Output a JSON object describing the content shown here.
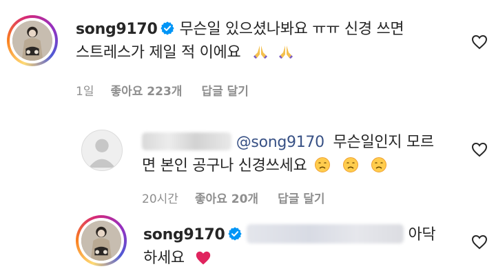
{
  "comments": [
    {
      "username": "song9170",
      "text_line1": "무슨일 있으셨나봐요 ㅠㅠ 신경 쓰면",
      "text_line2": "스트레스가 제일 적 이에요",
      "time": "1일",
      "likes": "좋아요 223개",
      "reply": "답글 달기",
      "verified": true,
      "emoji": "folded-hands"
    },
    {
      "mention": "@song9170",
      "text_line1": "무슨일인지 모르",
      "text_line2": "면 본인 공구나 신경쓰세요",
      "time": "20시간",
      "likes": "좋아요 20개",
      "reply": "답글 달기",
      "emoji": "disappointed-face"
    },
    {
      "username": "song9170",
      "text_line1_tail": "아닥",
      "text_line2": "하세요",
      "verified": true,
      "emoji": "red-heart"
    }
  ],
  "colors": {
    "verified_blue": "#0095f6",
    "meta_gray": "#8e8e8e",
    "mention_blue": "#385185",
    "heart_red": "#e0245e"
  }
}
